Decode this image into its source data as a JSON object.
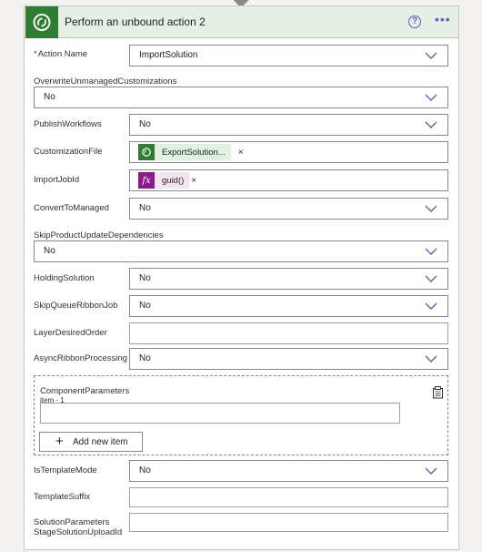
{
  "header": {
    "title": "Perform an unbound action 2",
    "help_glyph": "?",
    "more_glyph": "•••",
    "brand_color": "#2e7d32"
  },
  "fields": {
    "action_name": {
      "label": "Action Name",
      "required_mark": "*",
      "value": "ImportSolution"
    },
    "overwrite": {
      "label": "OverwriteUnmanagedCustomizations",
      "value": "No"
    },
    "publish_workflows": {
      "label": "PublishWorkflows",
      "value": "No"
    },
    "customization_file": {
      "label": "CustomizationFile",
      "token": "ExportSolution...",
      "remove": "×"
    },
    "import_job_id": {
      "label": "ImportJobId",
      "token": "guid()",
      "token_icon": "fx",
      "remove": "×"
    },
    "convert_to_managed": {
      "label": "ConvertToManaged",
      "value": "No"
    },
    "skip_product_update": {
      "label": "SkipProductUpdateDependencies",
      "value": "No"
    },
    "holding_solution": {
      "label": "HoldingSolution",
      "value": "No"
    },
    "skip_queue_ribbon": {
      "label": "SkipQueueRibbonJob",
      "value": "No"
    },
    "layer_desired_order": {
      "label": "LayerDesiredOrder",
      "value": ""
    },
    "async_ribbon": {
      "label": "AsyncRibbonProcessing",
      "value": "No"
    },
    "component_parameters": {
      "label": "ComponentParameters",
      "item_label": "item - 1",
      "item_value": "",
      "add_label": "Add new item",
      "add_glyph": "+"
    },
    "is_template_mode": {
      "label": "IsTemplateMode",
      "value": "No"
    },
    "template_suffix": {
      "label": "TemplateSuffix",
      "value": ""
    },
    "stage_solution": {
      "label_line1": "SolutionParameters",
      "label_line2": "StageSolutionUploadId",
      "value": ""
    }
  }
}
